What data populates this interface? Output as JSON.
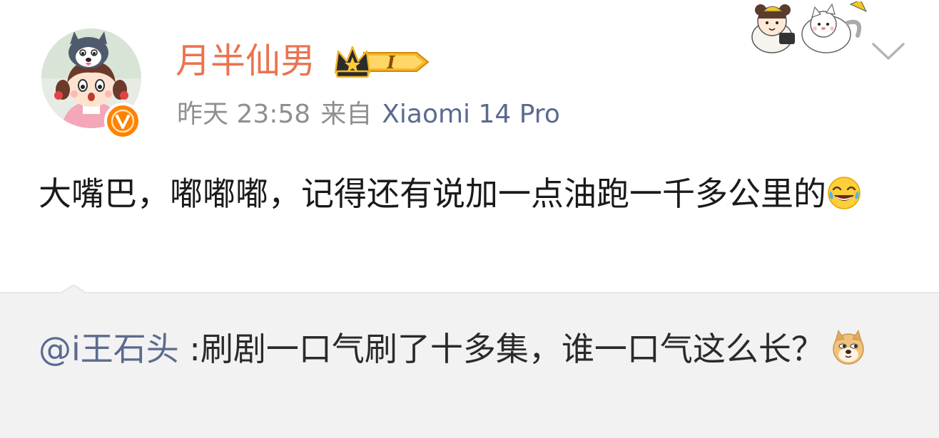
{
  "post": {
    "author": {
      "name": "月半仙男",
      "vip_level": "I",
      "avatar_icon": "husky-girl-avatar",
      "verified_icon": "orange-v-badge"
    },
    "time": "昨天 23:58",
    "source_prefix": "来自",
    "source_device": "Xiaomi 14 Pro",
    "text": "大嘴巴，嘟嘟嘟，记得还有说加一点油跑一千多公里的",
    "emoji": "laughing-tears-emoji"
  },
  "repost": {
    "mention": "@i王石头",
    "text": " :刷剧一口气刷了十多集，谁一口气这么长？",
    "emoji": "doge-emoji"
  },
  "colors": {
    "username": "#eb7350",
    "link": "#5b6a8e",
    "meta": "#8f8f8f",
    "repost_bg": "#f2f2f2",
    "badge": "#ff8200"
  }
}
